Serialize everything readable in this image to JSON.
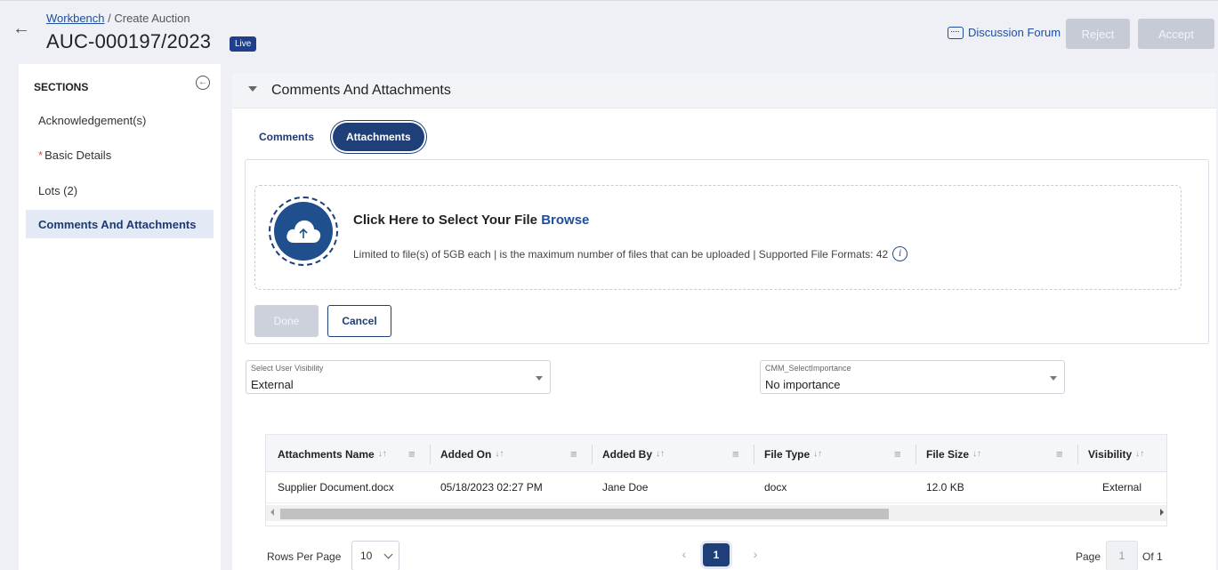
{
  "header": {
    "breadcrumb_link": "Workbench",
    "breadcrumb_current": " / Create Auction",
    "title": "AUC-000197/2023",
    "status_badge": "Live",
    "discussion_forum": "Discussion Forum",
    "reject_label": "Reject",
    "accept_label": "Accept"
  },
  "sidebar": {
    "heading": "SECTIONS",
    "items": [
      {
        "label": "Acknowledgement(s)",
        "required": false
      },
      {
        "label": "Basic Details",
        "required": true,
        "marker": "*"
      },
      {
        "label": "Lots (2)",
        "required": false
      },
      {
        "label": "Comments And Attachments",
        "required": false,
        "active": true
      }
    ]
  },
  "section": {
    "title": "Comments And Attachments",
    "tabs": [
      {
        "label": "Comments",
        "active": false
      },
      {
        "label": "Attachments",
        "active": true
      }
    ]
  },
  "upload": {
    "title": "Click Here to Select Your File",
    "browse": "Browse",
    "limits": "Limited to file(s) of 5GB each | is the maximum number of files that can be uploaded | Supported File Formats: 42",
    "done_label": "Done",
    "cancel_label": "Cancel"
  },
  "filters": {
    "visibility_label": "Select User Visibility",
    "visibility_value": "External",
    "importance_label": "CMM_SelectImportance",
    "importance_value": "No importance"
  },
  "table": {
    "columns": [
      "Attachments Name",
      "Added On",
      "Added By",
      "File Type",
      "File Size",
      "Visibility"
    ],
    "sort_glyph": "↓↑",
    "rows": [
      [
        "Supplier Document.docx",
        "05/18/2023 02:27 PM",
        "Jane Doe",
        "docx",
        "12.0 KB",
        "External"
      ]
    ]
  },
  "pagination": {
    "rows_per_page_label": "Rows Per Page",
    "rows_per_page_value": "10",
    "current_page": "1",
    "page_label": "Page",
    "page_input": "1",
    "of_label": "Of 1"
  },
  "colors": {
    "primary": "#1f3f78",
    "link": "#1f4e9c",
    "badge": "#1f3f8a",
    "disabled": "#c6cbd6"
  }
}
